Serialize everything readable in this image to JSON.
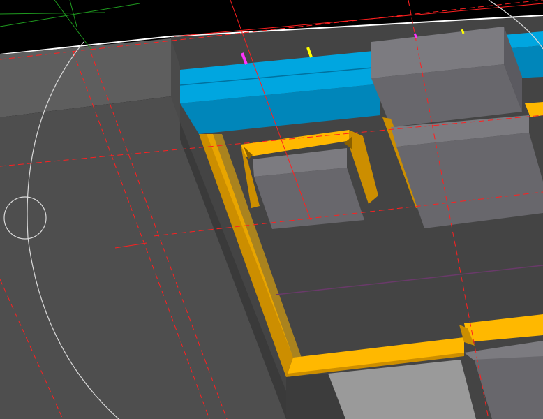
{
  "viewport": {
    "kind": "3d-cad-viewport",
    "background_color": "#000000"
  },
  "colors": {
    "floor": "#444444",
    "wall_top": "#5e5e5e",
    "wall_side": "#4e4e4e",
    "wall_front": "#3a3a3a",
    "blue_top": "#00a6e0",
    "blue_front": "#0086ba",
    "orange_light": "#ffb800",
    "orange_dark": "#cc8e00",
    "box_top": "#7c7b80",
    "box_side": "#68676c",
    "box_shadow": "#58575c",
    "guide_red": "#ff2020",
    "guide_green": "#1f9a1f",
    "circle_white": "#d9d9d9",
    "edge_white": "#ffffff",
    "marker_magenta": "#ff33ff",
    "marker_yellow": "#ffff00",
    "purple_line": "#6a3a6a"
  },
  "objects": [
    {
      "name": "large-wall-block",
      "icon": "block-3d-icon"
    },
    {
      "name": "blue-beam",
      "icon": "beam-3d-icon"
    },
    {
      "name": "orange-frame",
      "icon": "frame-3d-icon"
    },
    {
      "name": "small-orange-frame",
      "icon": "frame-3d-icon"
    },
    {
      "name": "inner-box",
      "icon": "cube-3d-icon"
    },
    {
      "name": "right-box",
      "icon": "cube-3d-icon"
    },
    {
      "name": "bottom-box",
      "icon": "cube-3d-icon"
    }
  ],
  "overlays": {
    "snap_circle": "snap-target-icon",
    "guides": "construction-guide-lines"
  }
}
